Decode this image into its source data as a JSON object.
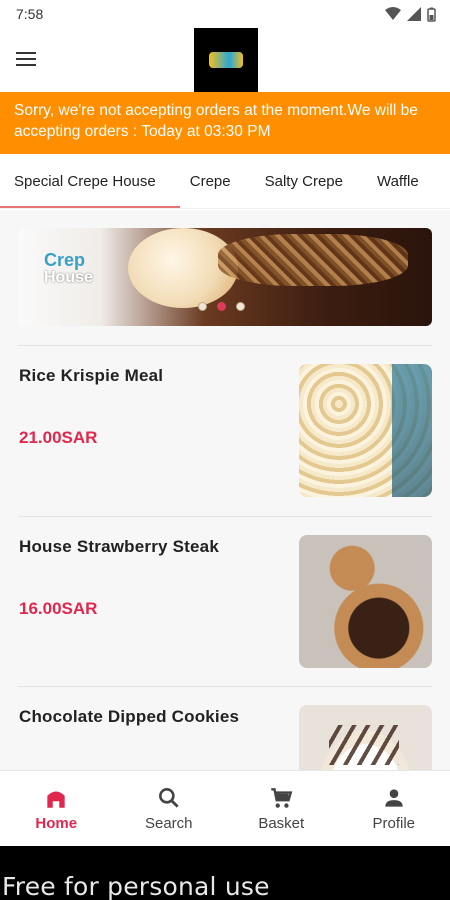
{
  "status_bar": {
    "time": "7:58"
  },
  "notice": {
    "text": "Sorry, we're not accepting orders at the moment.We will be accepting orders : Today at 03:30 PM"
  },
  "tabs": [
    {
      "label": "Special Crepe House",
      "active": true
    },
    {
      "label": "Crepe"
    },
    {
      "label": "Salty Crepe"
    },
    {
      "label": "Waffle"
    }
  ],
  "banner": {
    "dots": 3,
    "active_dot": 2
  },
  "items": [
    {
      "name": "Rice Krispie Meal",
      "price": "21.00SAR"
    },
    {
      "name": "House Strawberry Steak",
      "price": "16.00SAR"
    },
    {
      "name": "Chocolate Dipped Cookies",
      "price": ""
    }
  ],
  "bottom_nav": {
    "home": "Home",
    "search": "Search",
    "basket": "Basket",
    "profile": "Profile"
  },
  "footer": {
    "text": "Free for personal use"
  },
  "colors": {
    "accent": "#e0284f",
    "notice": "#ff8f00",
    "tab_underline": "#e57373"
  }
}
